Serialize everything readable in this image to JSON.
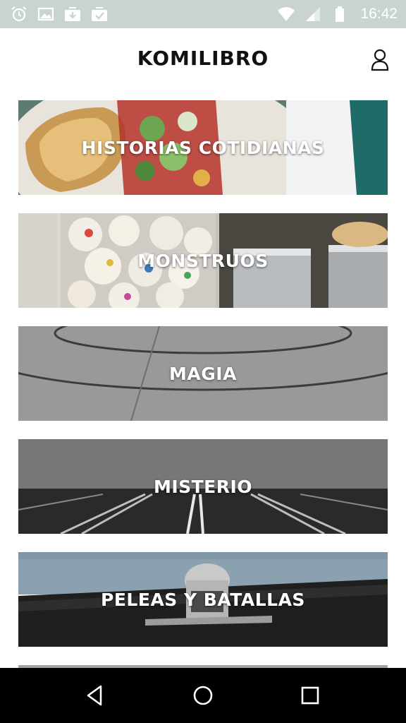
{
  "status_bar": {
    "time": "16:42",
    "left_icons": [
      "alarm-icon",
      "image-icon",
      "download-icon",
      "checklist-icon"
    ],
    "right_icons": [
      "wifi-icon",
      "signal-icon",
      "battery-icon"
    ]
  },
  "header": {
    "title": "KOMILIBRO",
    "profile_icon": "user-icon"
  },
  "categories": [
    {
      "label": "HISTORIAS COTIDIANAS"
    },
    {
      "label": "MONSTRUOS"
    },
    {
      "label": "MAGIA"
    },
    {
      "label": "MISTERIO"
    },
    {
      "label": "PELEAS Y BATALLAS"
    }
  ],
  "nav_bar": {
    "icons": [
      "back-icon",
      "home-icon",
      "recents-icon"
    ]
  }
}
